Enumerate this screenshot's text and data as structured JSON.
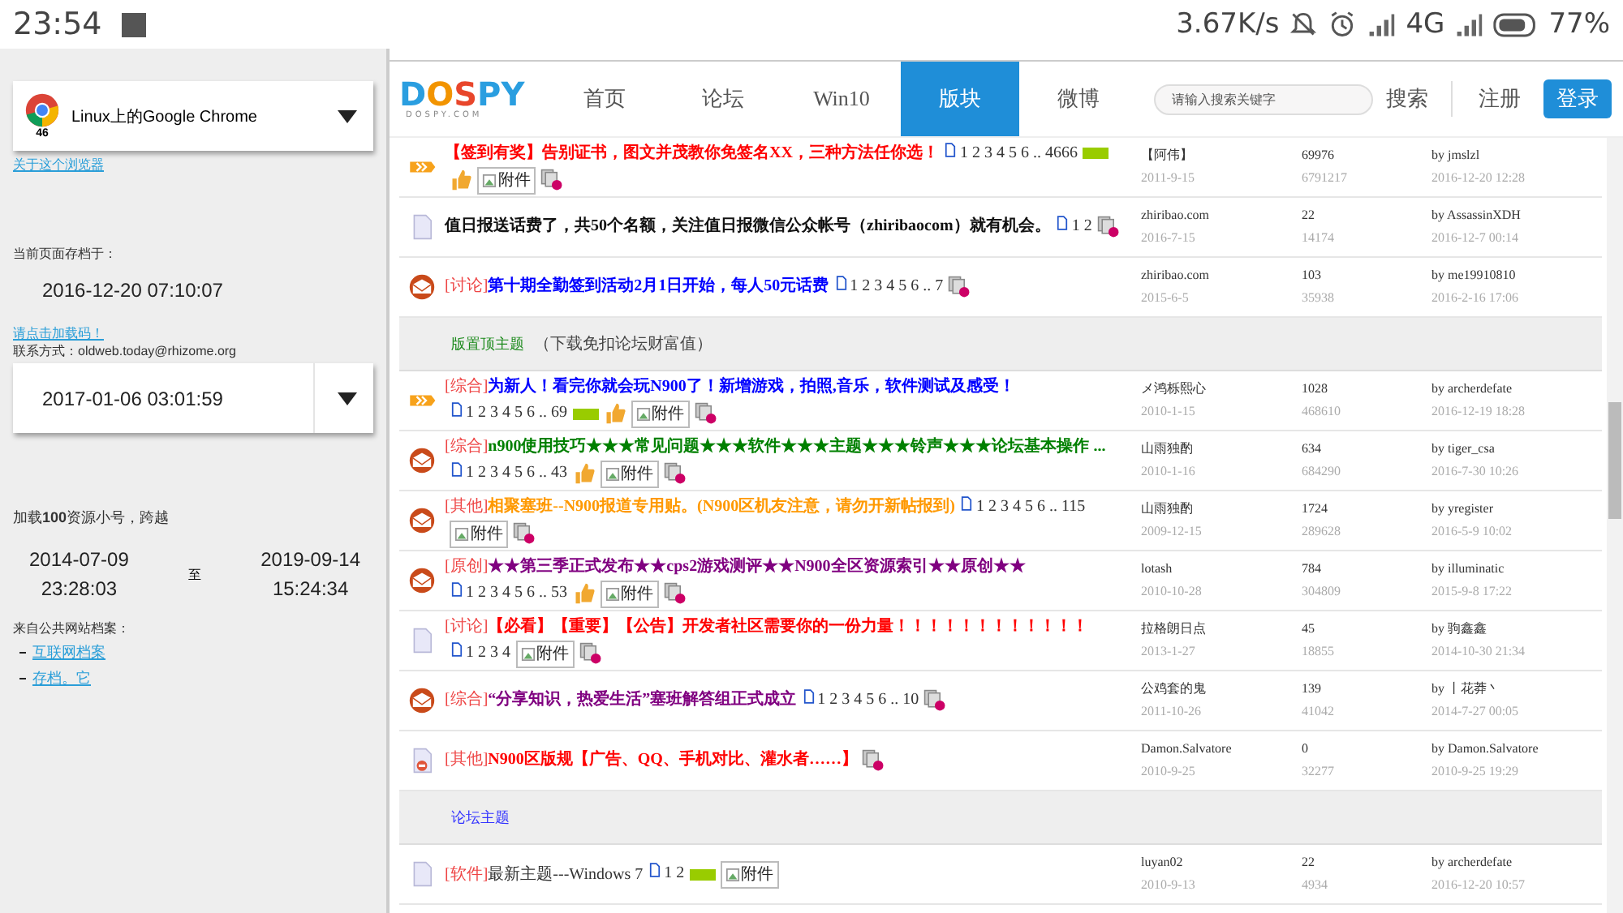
{
  "status_bar": {
    "time": "23:54",
    "speed": "3.67K/s",
    "network": "4G",
    "battery": "77%"
  },
  "sidebar": {
    "browser": {
      "name": "Linux上的Google Chrome",
      "version": "46"
    },
    "about_link": "关于这个浏览器",
    "archived_label": "当前页面存档于：",
    "archived_time": "2016-12-20  07:10:07",
    "notice_link": "请点击加载码！",
    "contact": "联系方式：oldweb.today@rhizome.org",
    "date_select": "2017-01-06  03:01:59",
    "range_text": "加载**100**资源小号，跨越",
    "range_from": {
      "date": "2014-07-09",
      "time": "23:28:03"
    },
    "range_sep": "至",
    "range_to": {
      "date": "2019-09-14",
      "time": "15:24:34"
    },
    "sources_label": "来自公共网站档案：",
    "sources": [
      "互联网档案",
      "存档。它"
    ]
  },
  "site": {
    "logo": "DOSPY",
    "logo_sub": "DOSPY.COM",
    "nav": [
      {
        "label": "首页",
        "selected": false
      },
      {
        "label": "论坛",
        "selected": false
      },
      {
        "label": "Win10",
        "selected": false
      },
      {
        "label": "版块",
        "selected": true
      },
      {
        "label": "微博",
        "selected": false
      }
    ],
    "search": {
      "placeholder": "请输入搜索关键字",
      "button": "搜索"
    },
    "register": "注册",
    "login": "登录"
  },
  "threads": [
    {
      "kind": "hot",
      "title": "【签到有奖】告别证书，图文并茂教你免签名XX，三种方法任你选！",
      "color": "#ff0000",
      "bold": true,
      "pages": "1 2 3 4 5 6 .. 4666",
      "badges": [
        {
          "kind": "new"
        },
        {
          "kind": "thumb"
        },
        {
          "kind": "attach",
          "label": "附件"
        },
        {
          "kind": "multi"
        }
      ],
      "author": "【阿伟】",
      "date": "2011-9-15",
      "replies": "69976",
      "views": "6791217",
      "last_by": "by jmslzl",
      "last_time": "2016-12-20 12:28"
    },
    {
      "kind": "normal",
      "title": "值日报送话费了，共50个名额，关注值日报微信公众帐号（zhiribaocom）就有机会。",
      "color": "#111111",
      "bold": true,
      "pages": "1 2",
      "badges": [
        {
          "kind": "multi"
        }
      ],
      "author": "zhiribao.com",
      "date": "2016-7-15",
      "replies": "22",
      "views": "14174",
      "last_by": "by AssassinXDH",
      "last_time": "2016-12-7 00:14"
    },
    {
      "kind": "unread",
      "tag": "[讨论]",
      "title": "第十期全勤签到活动2月1日开始，每人50元话费",
      "color": "#0000ff",
      "bold": true,
      "pages": "1 2 3 4 5 6 .. 7",
      "badges": [
        {
          "kind": "multi"
        }
      ],
      "author": "zhiribao.com",
      "date": "2015-6-5",
      "replies": "103",
      "views": "35938",
      "last_by": "by me19910810",
      "last_time": "2016-2-16 17:06"
    },
    {
      "kind": "section",
      "label": "版置顶主题",
      "note": "（下载免扣论坛财富值）",
      "color": "#1c8a1c"
    },
    {
      "kind": "hot",
      "tag": "[综合]",
      "title": "为新人！看完你就会玩N900了！新增游戏，拍照,音乐，软件测试及感受！",
      "color": "#0000ff",
      "bold": true,
      "pages": "1 2 3 4 5 6 .. 69",
      "badges": [
        {
          "kind": "new"
        },
        {
          "kind": "thumb"
        },
        {
          "kind": "attach",
          "label": "附件"
        },
        {
          "kind": "multi"
        }
      ],
      "author": "メ鸿栎熙心",
      "date": "2010-1-15",
      "replies": "1028",
      "views": "468610",
      "last_by": "by archerdefate",
      "last_time": "2016-12-19 18:28"
    },
    {
      "kind": "unread",
      "tag": "[综合]",
      "title": "n900使用技巧★★★常见问题★★★软件★★★主题★★★铃声★★★论坛基本操作 ...",
      "color": "#008000",
      "bold": true,
      "pages": "1 2 3 4 5 6 .. 43",
      "badges": [
        {
          "kind": "thumb"
        },
        {
          "kind": "attach",
          "label": "附件"
        },
        {
          "kind": "multi"
        }
      ],
      "author": "山雨独酌",
      "date": "2010-1-16",
      "replies": "634",
      "views": "684290",
      "last_by": "by tiger_csa",
      "last_time": "2016-7-30 10:26"
    },
    {
      "kind": "unread",
      "tag": "[其他]",
      "title": "相聚塞班--N900报道专用贴。(N900区机友注意，请勿开新帖报到)",
      "color": "#ff9900",
      "bold": true,
      "pages": "1 2 3 4 5 6 .. 115",
      "badges": [
        {
          "kind": "attach",
          "label": "附件"
        },
        {
          "kind": "multi"
        }
      ],
      "author": "山雨独酌",
      "date": "2009-12-15",
      "replies": "1724",
      "views": "289628",
      "last_by": "by yregister",
      "last_time": "2016-5-9 10:02"
    },
    {
      "kind": "unread",
      "tag": "[原创]",
      "title": "★★第三季正式发布★★cps2游戏测评★★N900全区资源索引★★原创★★",
      "color": "#800080",
      "bold": true,
      "pages": "1 2 3 4 5 6 .. 53",
      "badges": [
        {
          "kind": "thumb"
        },
        {
          "kind": "attach",
          "label": "附件"
        },
        {
          "kind": "multi"
        }
      ],
      "author": "lotash",
      "date": "2010-10-28",
      "replies": "784",
      "views": "304809",
      "last_by": "by illuminatic",
      "last_time": "2015-9-8 17:22"
    },
    {
      "kind": "normal",
      "tag": "[讨论]",
      "title": "【必看】【重要】【公告】开发者社区需要你的一份力量！！！！！！！！！！！！",
      "color": "#ff0000",
      "bold": true,
      "pages": "1 2 3 4",
      "badges": [
        {
          "kind": "attach",
          "label": "附件"
        },
        {
          "kind": "multi"
        }
      ],
      "author": "拉格朗日点",
      "date": "2013-1-27",
      "replies": "45",
      "views": "18855",
      "last_by": "by 驹鑫鑫",
      "last_time": "2014-10-30 21:34"
    },
    {
      "kind": "unread",
      "tag": "[综合]",
      "title": "“分享知识，热爱生活”塞班解答组正式成立",
      "color": "#800080",
      "bold": true,
      "pages": "1 2 3 4 5 6 .. 10",
      "badges": [
        {
          "kind": "multi"
        }
      ],
      "author": "公鸡套的鬼",
      "date": "2011-10-26",
      "replies": "139",
      "views": "41042",
      "last_by": "by 丨花莽丶",
      "last_time": "2014-7-27 00:05"
    },
    {
      "kind": "closed",
      "tag": "[其他]",
      "title": "N900区版规【广告、QQ、手机对比、灌水者……】",
      "color": "#ff0000",
      "bold": true,
      "badges": [
        {
          "kind": "multi"
        }
      ],
      "author": "Damon.Salvatore",
      "date": "2010-9-25",
      "replies": "0",
      "views": "32277",
      "last_by": "by Damon.Salvatore",
      "last_time": "2010-9-25 19:29"
    },
    {
      "kind": "section",
      "label": "论坛主题",
      "color": "#3333ff"
    },
    {
      "kind": "normal",
      "tag": "[软件]",
      "title": "最新主题---Windows 7",
      "color": "#333333",
      "bold": false,
      "pages": "1 2",
      "badges": [
        {
          "kind": "new"
        },
        {
          "kind": "attach",
          "label": "附件"
        }
      ],
      "author": "luyan02",
      "date": "2010-9-13",
      "replies": "22",
      "views": "4934",
      "last_by": "by archerdefate",
      "last_time": "2016-12-20 10:57"
    }
  ]
}
